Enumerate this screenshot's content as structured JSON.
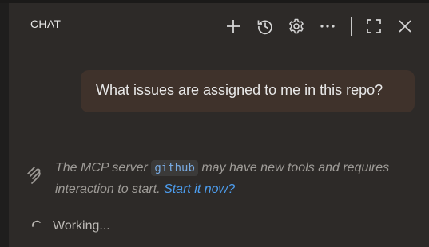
{
  "header": {
    "tab_title": "CHAT",
    "icons": [
      "plus-icon",
      "history-icon",
      "gear-icon",
      "more-icon",
      "maximize-icon",
      "close-icon"
    ]
  },
  "conversation": {
    "user_message": "What issues are assigned to me in this repo?",
    "notice": {
      "prefix": "The MCP server ",
      "server_name": "github",
      "middle": " may have new tools and requires interaction to start. ",
      "link": "Start it now?"
    },
    "status": "Working..."
  },
  "colors": {
    "panel_bg": "#2d2a28",
    "bubble_bg": "#3f322b",
    "link": "#4d9ef0",
    "code": "#78a9e0"
  }
}
